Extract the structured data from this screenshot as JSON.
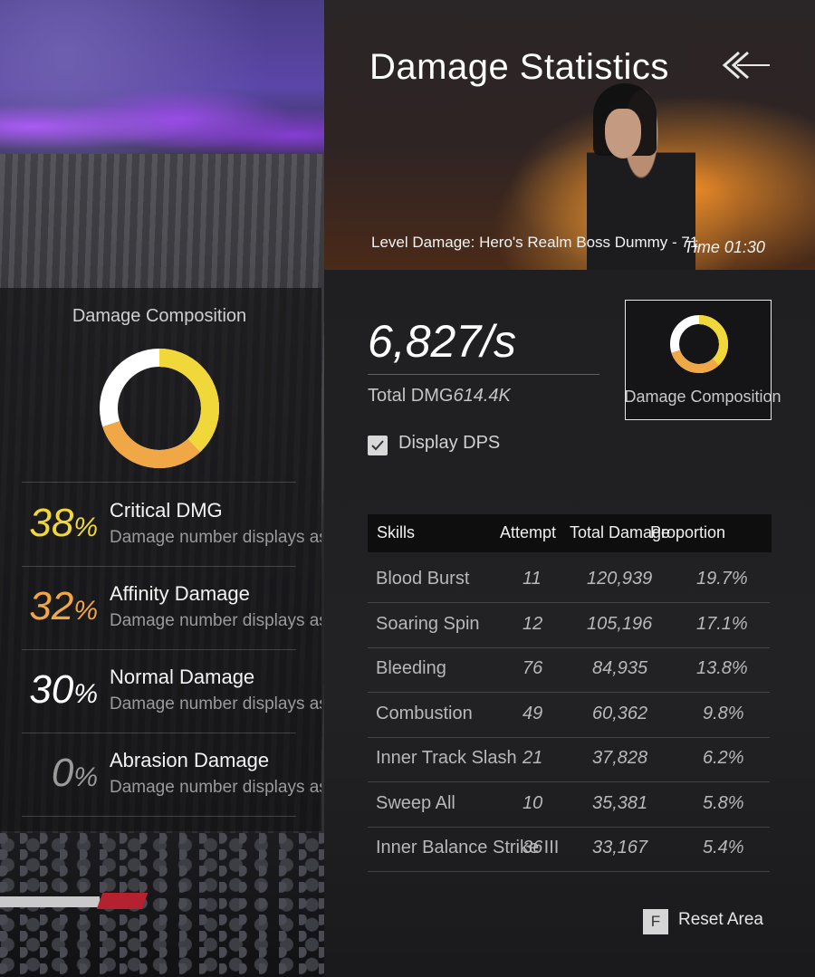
{
  "header": {
    "title": "Damage Statistics",
    "level_text": "Level Damage: Hero's Realm Boss Dummy - 71",
    "time_text": "Time 01:30"
  },
  "summary": {
    "dps": "6,827/s",
    "total_label": "Total DMG",
    "total_value": "614.4K",
    "composition_button_label": "Damage Composition",
    "display_dps_label": "Display DPS",
    "display_dps_checked": true
  },
  "composition": {
    "title": "Damage Composition",
    "items": [
      {
        "percent": "38",
        "unit": "%",
        "name": "Critical DMG",
        "desc": "Damage number displays as",
        "color": "#f0d83a"
      },
      {
        "percent": "32",
        "unit": "%",
        "name": "Affinity Damage",
        "desc": "Damage number displays as",
        "color": "#f0a745"
      },
      {
        "percent": "30",
        "unit": "%",
        "name": "Normal Damage",
        "desc": "Damage number displays as",
        "color": "#ffffff"
      },
      {
        "percent": "0",
        "unit": "%",
        "name": "Abrasion Damage",
        "desc": "Damage number displays as",
        "color": "#9a9a9a"
      }
    ]
  },
  "table": {
    "headers": {
      "skills": "Skills",
      "attempt": "Attempt",
      "total": "Total Damage",
      "proportion": "Proportion"
    },
    "rows": [
      {
        "skill": "Blood Burst",
        "attempt": "11",
        "total": "120,939",
        "proportion": "19.7%"
      },
      {
        "skill": "Soaring Spin",
        "attempt": "12",
        "total": "105,196",
        "proportion": "17.1%"
      },
      {
        "skill": "Bleeding",
        "attempt": "76",
        "total": "84,935",
        "proportion": "13.8%"
      },
      {
        "skill": "Combustion",
        "attempt": "49",
        "total": "60,362",
        "proportion": "9.8%"
      },
      {
        "skill": "Inner Track Slash",
        "attempt": "21",
        "total": "37,828",
        "proportion": "6.2%"
      },
      {
        "skill": "Sweep All",
        "attempt": "10",
        "total": "35,381",
        "proportion": "5.8%"
      },
      {
        "skill": "Inner Balance Strike III",
        "attempt": "36",
        "total": "33,167",
        "proportion": "5.4%"
      }
    ]
  },
  "footer": {
    "key": "F",
    "reset_label": "Reset Area"
  },
  "colors": {
    "critical": "#f0d83a",
    "affinity": "#f0a745",
    "normal": "#ffffff",
    "abrasion": "#9a9a9a"
  }
}
